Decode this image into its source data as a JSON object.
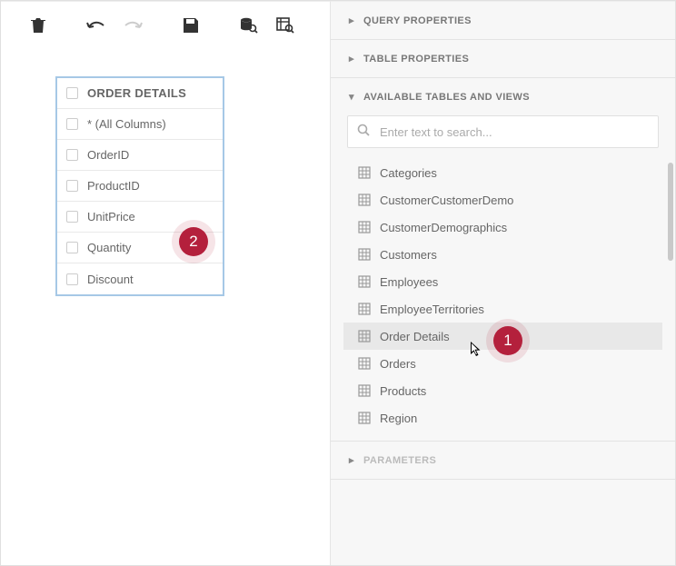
{
  "toolbar": {
    "trash": "trash-icon",
    "undo": "undo-icon",
    "redo": "redo-icon",
    "save": "save-icon",
    "query_preview": "query-preview-icon",
    "results_preview": "results-preview-icon"
  },
  "table_card": {
    "title": "ORDER DETAILS",
    "columns": [
      "* (All Columns)",
      "OrderID",
      "ProductID",
      "UnitPrice",
      "Quantity",
      "Discount"
    ]
  },
  "badges": {
    "one": "1",
    "two": "2"
  },
  "panels": {
    "query_props": "QUERY PROPERTIES",
    "table_props": "TABLE PROPERTIES",
    "avail": "AVAILABLE TABLES AND VIEWS",
    "params": "PARAMETERS",
    "search_placeholder": "Enter text to search...",
    "tables": [
      {
        "name": "Categories",
        "selected": false
      },
      {
        "name": "CustomerCustomerDemo",
        "selected": false
      },
      {
        "name": "CustomerDemographics",
        "selected": false
      },
      {
        "name": "Customers",
        "selected": false
      },
      {
        "name": "Employees",
        "selected": false
      },
      {
        "name": "EmployeeTerritories",
        "selected": false
      },
      {
        "name": "Order Details",
        "selected": true
      },
      {
        "name": "Orders",
        "selected": false
      },
      {
        "name": "Products",
        "selected": false
      },
      {
        "name": "Region",
        "selected": false
      }
    ]
  }
}
